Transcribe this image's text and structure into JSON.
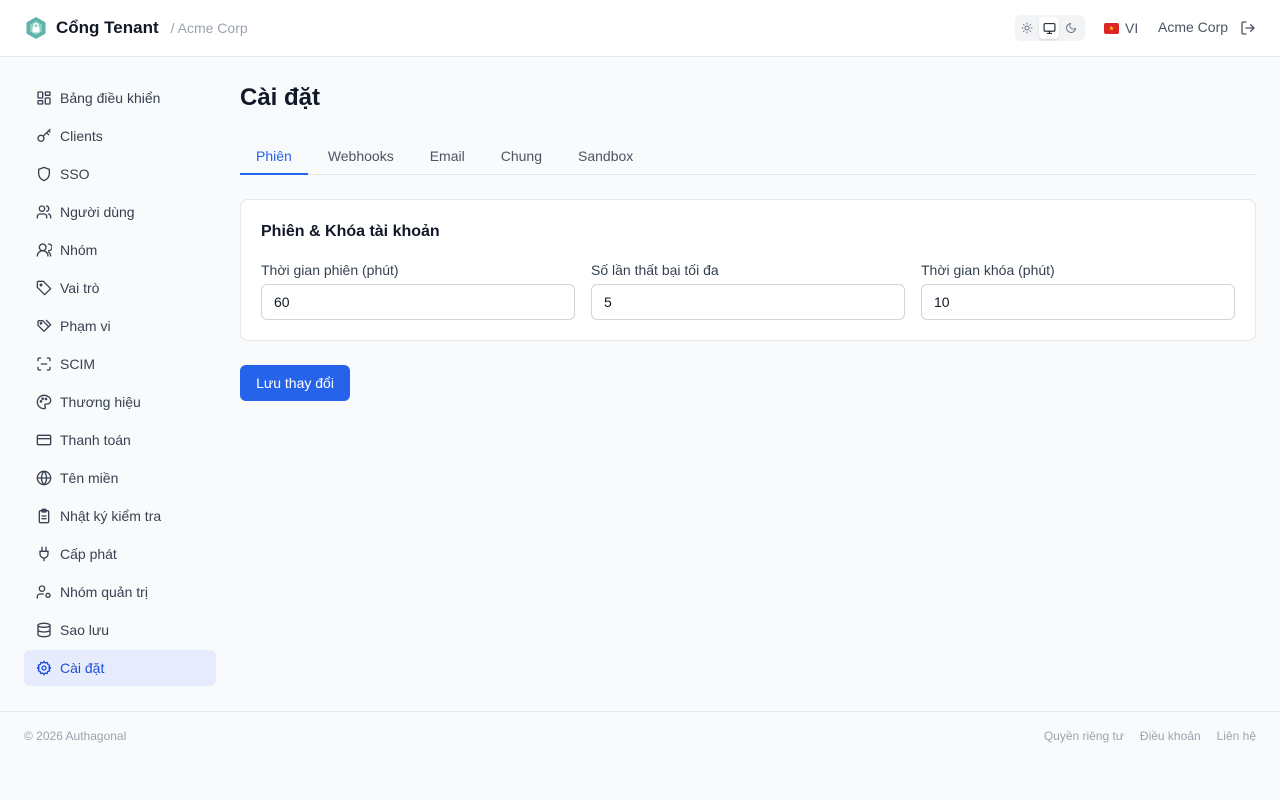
{
  "header": {
    "app_title": "Cổng Tenant",
    "tenant_crumb": "/ Acme Corp",
    "logo_icon": "shield-lock-icon",
    "theme_options": [
      {
        "icon": "sun-icon",
        "active": false
      },
      {
        "icon": "monitor-icon",
        "active": true
      },
      {
        "icon": "moon-icon",
        "active": false
      }
    ],
    "language": {
      "flag_icon": "vietnam-flag-icon",
      "code": "VI"
    },
    "org_name": "Acme Corp",
    "logout_icon": "logout-icon"
  },
  "sidebar": {
    "items": [
      {
        "label": "Bảng điều khiển",
        "icon": "dashboard-grid-icon",
        "active": false
      },
      {
        "label": "Clients",
        "icon": "key-icon",
        "active": false
      },
      {
        "label": "SSO",
        "icon": "shield-icon",
        "active": false
      },
      {
        "label": "Người dùng",
        "icon": "users-icon",
        "active": false
      },
      {
        "label": "Nhóm",
        "icon": "user-group-icon",
        "active": false
      },
      {
        "label": "Vai trò",
        "icon": "tag-icon",
        "active": false
      },
      {
        "label": "Phạm vi",
        "icon": "tags-icon",
        "active": false
      },
      {
        "label": "SCIM",
        "icon": "scan-icon",
        "active": false
      },
      {
        "label": "Thương hiệu",
        "icon": "palette-icon",
        "active": false
      },
      {
        "label": "Thanh toán",
        "icon": "credit-card-icon",
        "active": false
      },
      {
        "label": "Tên miền",
        "icon": "globe-icon",
        "active": false
      },
      {
        "label": "Nhật ký kiểm tra",
        "icon": "clipboard-icon",
        "active": false
      },
      {
        "label": "Cấp phát",
        "icon": "plug-icon",
        "active": false
      },
      {
        "label": "Nhóm quản trị",
        "icon": "user-cog-icon",
        "active": false
      },
      {
        "label": "Sao lưu",
        "icon": "database-icon",
        "active": false
      },
      {
        "label": "Cài đặt",
        "icon": "gear-icon",
        "active": true
      }
    ]
  },
  "main": {
    "title": "Cài đặt",
    "tabs": [
      {
        "label": "Phiên",
        "active": true
      },
      {
        "label": "Webhooks",
        "active": false
      },
      {
        "label": "Email",
        "active": false
      },
      {
        "label": "Chung",
        "active": false
      },
      {
        "label": "Sandbox",
        "active": false
      }
    ],
    "card": {
      "title": "Phiên & Khóa tài khoản",
      "fields": [
        {
          "label": "Thời gian phiên (phút)",
          "value": "60"
        },
        {
          "label": "Số lần thất bại tối đa",
          "value": "5"
        },
        {
          "label": "Thời gian khóa (phút)",
          "value": "10"
        }
      ]
    },
    "save_label": "Lưu thay đổi"
  },
  "footer": {
    "copyright": "© 2026 Authagonal",
    "links": [
      "Quyền riêng tư",
      "Điều khoản",
      "Liên hệ"
    ]
  },
  "colors": {
    "accent": "#2563eb",
    "active_nav_bg": "#e6ecfb",
    "logo": "#5fb3a8"
  }
}
